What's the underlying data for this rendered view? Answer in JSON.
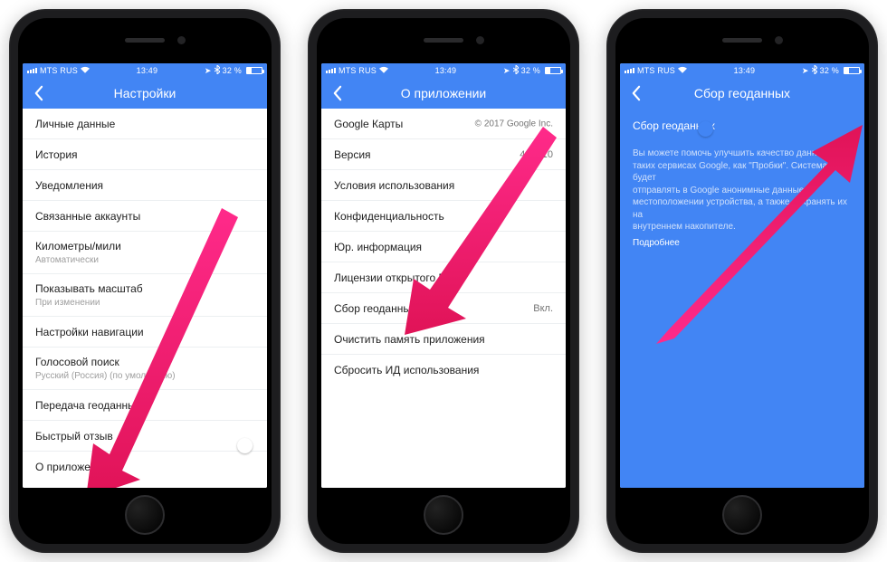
{
  "statusbar": {
    "carrier": "MTS RUS",
    "time": "13:49",
    "battery_pct": "32 %",
    "bt_icon": "bluetooth",
    "arrow_icon": "location-arrow"
  },
  "screen1": {
    "title": "Настройки",
    "rows": [
      {
        "label": "Личные данные"
      },
      {
        "label": "История"
      },
      {
        "label": "Уведомления"
      },
      {
        "label": "Связанные аккаунты"
      },
      {
        "label": "Километры/мили",
        "sub": "Автоматически"
      },
      {
        "label": "Показывать масштаб",
        "sub": "При изменении"
      },
      {
        "label": "Настройки навигации"
      },
      {
        "label": "Голосовой поиск",
        "sub": "Русский (Россия) (по умолчанию)"
      },
      {
        "label": "Передача геоданных"
      },
      {
        "label": "Быстрый отзыв",
        "toggle": true
      },
      {
        "label": "О приложении"
      }
    ]
  },
  "screen2": {
    "title": "О приложении",
    "rows": [
      {
        "label": "Google Карты",
        "right": "© 2017 Google Inc."
      },
      {
        "label": "Версия",
        "right": "4.41.10"
      },
      {
        "label": "Условия использования"
      },
      {
        "label": "Конфиденциальность"
      },
      {
        "label": "Юр. информация"
      },
      {
        "label": "Лицензии открытого ПО"
      },
      {
        "label": "Сбор геоданных",
        "right": "Вкл."
      },
      {
        "label": "Очистить память приложения"
      },
      {
        "label": "Сбросить ИД использования"
      }
    ]
  },
  "screen3": {
    "title": "Сбор геоданных",
    "row_label": "Сбор геоданных",
    "toggle": true,
    "desc_lines": [
      "Вы можете помочь улучшить качество данных в",
      "таких сервисах Google, как \"Пробки\". Система будет",
      "отправлять в Google анонимные данные о",
      "местоположении устройства, а также сохранять их на",
      "внутреннем накопителе."
    ],
    "link": "Подробнее"
  },
  "colors": {
    "accent": "#4285f4",
    "arrow": "#ec2566"
  }
}
